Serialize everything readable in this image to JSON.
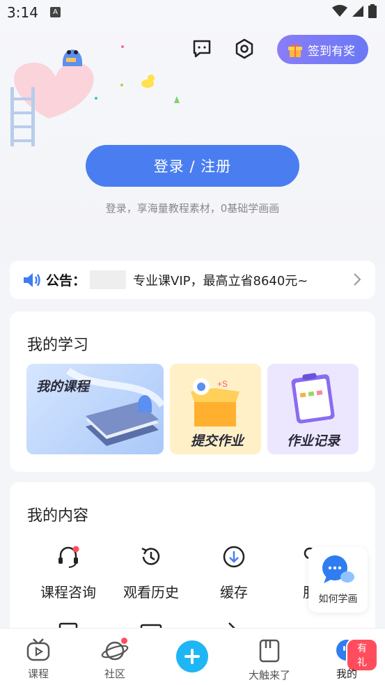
{
  "status_bar": {
    "time": "3:14",
    "notification_icon": "A"
  },
  "header": {
    "checkin_label": "签到有奖"
  },
  "login": {
    "button_label": "登录 / 注册",
    "subtitle": "登录，享海量教程素材，0基础学画画"
  },
  "notice": {
    "label": "公告：",
    "text": "专业课VIP，最高立省8640元~"
  },
  "study": {
    "title": "我的学习",
    "tiles": [
      {
        "label": "我的课程"
      },
      {
        "label": "提交作业"
      },
      {
        "label": "作业记录"
      }
    ]
  },
  "content": {
    "title": "我的内容",
    "items": [
      {
        "label": "课程咨询",
        "icon": "headset-icon"
      },
      {
        "label": "观看历史",
        "icon": "history-icon"
      },
      {
        "label": "缓存",
        "icon": "download-icon"
      },
      {
        "label": "服",
        "icon": "service-icon"
      }
    ]
  },
  "float_help": {
    "label": "如何学画"
  },
  "bottom_nav": {
    "items": [
      {
        "label": "课程",
        "icon": "tv-icon"
      },
      {
        "label": "社区",
        "icon": "planet-icon"
      },
      {
        "label": "",
        "icon": "plus-icon"
      },
      {
        "label": "大触来了",
        "icon": "book-icon"
      },
      {
        "label": "我的",
        "icon": "profile-icon",
        "badge": "有礼"
      }
    ]
  },
  "colors": {
    "primary": "#4a7ef0",
    "checkin": "#7b7af6",
    "fab": "#1fb6f5",
    "badge": "#ff4d5e"
  }
}
